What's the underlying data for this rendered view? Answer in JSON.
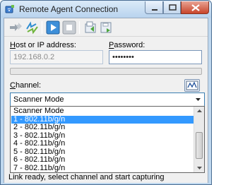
{
  "window": {
    "title": "Remote Agent Connection",
    "icon": "wifi-agent-icon",
    "controls": [
      "minimize-icon",
      "maximize-icon",
      "close-icon"
    ]
  },
  "toolbar": {
    "icons": [
      "connect-arrows-icon",
      "refresh-arrows-icon",
      "play-icon",
      "stop-icon",
      "open-file-icon",
      "save-file-icon"
    ]
  },
  "form": {
    "host_label_pre": "",
    "host_label_u": "H",
    "host_label_post": "ost or IP address:",
    "host_value": "192.168.0.2",
    "password_label_pre": "",
    "password_label_u": "P",
    "password_label_post": "assword:",
    "password_value": "••••••••",
    "progress": 0,
    "channel_label_pre": "",
    "channel_label_u": "C",
    "channel_label_post": "hannel:",
    "channel_value": "Scanner Mode"
  },
  "dropdown": {
    "options": [
      "Scanner Mode",
      "1 - 802.11b/g/n",
      "2 - 802.11b/g/n",
      "3 - 802.11b/g/n",
      "4 - 802.11b/g/n",
      "5 - 802.11b/g/n",
      "6 - 802.11b/g/n",
      "7 - 802.11b/g/n"
    ],
    "selected_index": 1
  },
  "status": {
    "text": "Link ready, select channel and start capturing"
  },
  "colors": {
    "selection": "#3399ff",
    "title_bg": "#bfd8ef",
    "close": "#c8452b"
  }
}
